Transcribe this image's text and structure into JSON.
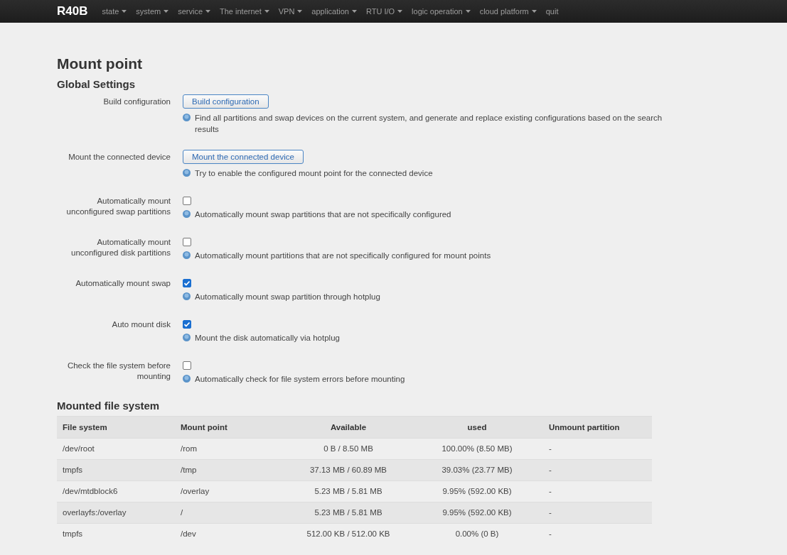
{
  "navbar": {
    "brand": "R40B",
    "menu": [
      {
        "label": "state",
        "dropdown": true
      },
      {
        "label": "system",
        "dropdown": true
      },
      {
        "label": "service",
        "dropdown": true
      },
      {
        "label": "The internet",
        "dropdown": true
      },
      {
        "label": "VPN",
        "dropdown": true
      },
      {
        "label": "application",
        "dropdown": true
      },
      {
        "label": "RTU I/O",
        "dropdown": true
      },
      {
        "label": "logic operation",
        "dropdown": true
      },
      {
        "label": "cloud platform",
        "dropdown": true
      },
      {
        "label": "quit",
        "dropdown": false
      }
    ]
  },
  "page_title": "Mount point",
  "global_settings": {
    "title": "Global Settings",
    "rows": [
      {
        "kind": "button",
        "label": "Build configuration",
        "button": "Build configuration",
        "help": "Find all partitions and swap devices on the current system, and generate and replace existing configurations based on the search results"
      },
      {
        "kind": "button",
        "label": "Mount the connected device",
        "button": "Mount the connected device",
        "help": "Try to enable the configured mount point for the connected device"
      },
      {
        "kind": "checkbox",
        "label": "Automatically mount unconfigured swap partitions",
        "checked": false,
        "help": "Automatically mount swap partitions that are not specifically configured"
      },
      {
        "kind": "checkbox",
        "label": "Automatically mount unconfigured disk partitions",
        "checked": false,
        "help": "Automatically mount partitions that are not specifically configured for mount points"
      },
      {
        "kind": "checkbox",
        "label": "Automatically mount swap",
        "checked": true,
        "help": "Automatically mount swap partition through hotplug"
      },
      {
        "kind": "checkbox",
        "label": "Auto mount disk",
        "checked": true,
        "help": "Mount the disk automatically via hotplug"
      },
      {
        "kind": "checkbox",
        "label": "Check the file system before mounting",
        "checked": false,
        "help": "Automatically check for file system errors before mounting"
      }
    ]
  },
  "mounted": {
    "title": "Mounted file system",
    "columns": [
      "File system",
      "Mount point",
      "Available",
      "used",
      "Unmount partition"
    ],
    "rows": [
      [
        "/dev/root",
        "/rom",
        "0 B / 8.50 MB",
        "100.00% (8.50 MB)",
        "-"
      ],
      [
        "tmpfs",
        "/tmp",
        "37.13 MB / 60.89 MB",
        "39.03% (23.77 MB)",
        "-"
      ],
      [
        "/dev/mtdblock6",
        "/overlay",
        "5.23 MB / 5.81 MB",
        "9.95% (592.00 KB)",
        "-"
      ],
      [
        "overlayfs:/overlay",
        "/",
        "5.23 MB / 5.81 MB",
        "9.95% (592.00 KB)",
        "-"
      ],
      [
        "tmpfs",
        "/dev",
        "512.00 KB / 512.00 KB",
        "0.00% (0 B)",
        "-"
      ]
    ]
  }
}
